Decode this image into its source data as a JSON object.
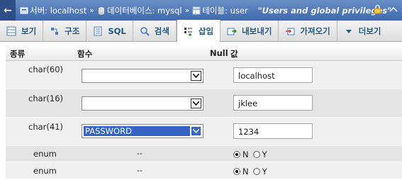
{
  "breadcrumb": {
    "server_label": "서버: localhost",
    "database_label": "데이터베이스: mysql",
    "table_label": "테이블: user",
    "separator": "»",
    "comment": "\"Users and global privileges\""
  },
  "tabs": [
    {
      "label": "보기",
      "icon": "browse-icon"
    },
    {
      "label": "구조",
      "icon": "structure-icon"
    },
    {
      "label": "SQL",
      "icon": "sql-icon"
    },
    {
      "label": "검색",
      "icon": "search-icon"
    },
    {
      "label": "삽입",
      "icon": "insert-icon",
      "active": true
    },
    {
      "label": "내보내기",
      "icon": "export-icon"
    },
    {
      "label": "가져오기",
      "icon": "import-icon"
    },
    {
      "label": "더보기",
      "icon": "chevron-down-icon"
    }
  ],
  "table": {
    "headers": {
      "type": "종류",
      "function": "함수",
      "null": "Null",
      "value": "값"
    },
    "rows": [
      {
        "type": "char(60)",
        "function": "",
        "value": "localhost"
      },
      {
        "type": "char(16)",
        "function": "",
        "value": "jklee"
      },
      {
        "type": "char(41)",
        "function": "PASSWORD",
        "value": "1234"
      },
      {
        "type": "enum",
        "function": "--",
        "radio_n": "N",
        "radio_y": "Y",
        "selected": "N"
      },
      {
        "type": "enum",
        "function": "--",
        "radio_n": "N",
        "radio_y": "Y",
        "selected": "N"
      }
    ]
  },
  "colors": {
    "accent": "#3f69ad",
    "tab_text": "#235a81",
    "selection": "#3464c4"
  }
}
